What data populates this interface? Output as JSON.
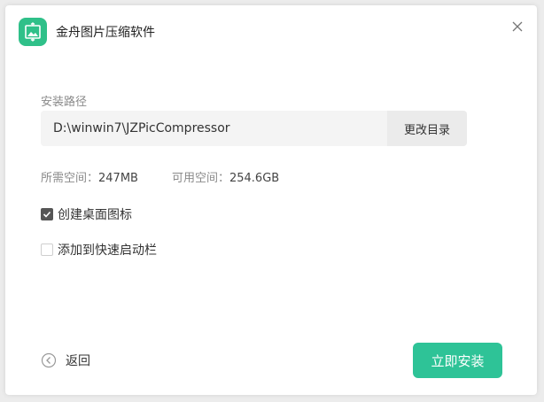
{
  "app": {
    "title": "金舟图片压缩软件",
    "icon": "image-compress-icon",
    "accent_color": "#2fc089"
  },
  "install": {
    "path_label": "安装路径",
    "path_value": "D:\\winwin7\\JZPicCompressor",
    "change_dir_label": "更改目录",
    "required_space_label": "所需空间：",
    "required_space_value": "247MB",
    "available_space_label": "可用空间：",
    "available_space_value": "254.6GB"
  },
  "options": [
    {
      "label": "创建桌面图标",
      "checked": true
    },
    {
      "label": "添加到快速启动栏",
      "checked": false
    }
  ],
  "footer": {
    "back_label": "返回",
    "install_label": "立即安装",
    "install_color": "#2ec397"
  }
}
